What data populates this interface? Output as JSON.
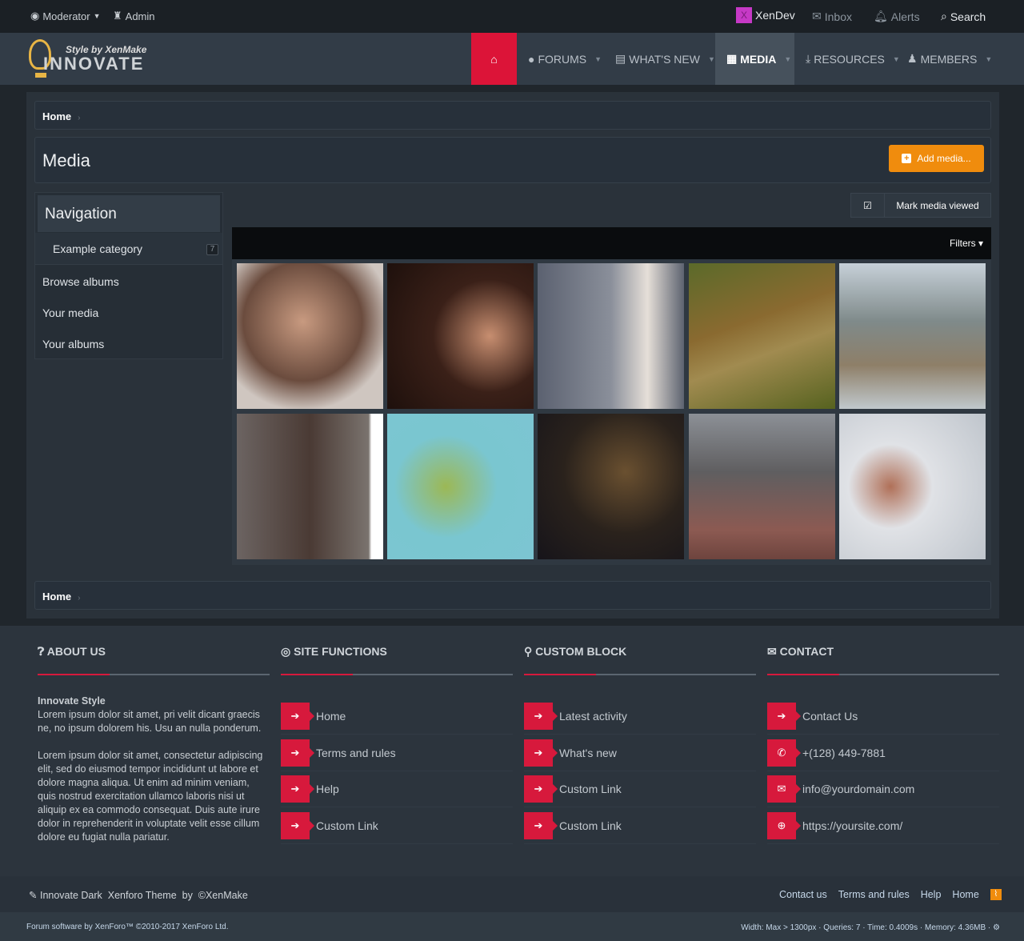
{
  "topbar": {
    "moderator": "Moderator",
    "admin": "Admin",
    "user": "XenDev",
    "user_initial": "X",
    "inbox": "Inbox",
    "alerts": "Alerts",
    "search": "Search"
  },
  "logo": {
    "tagline": "Style by XenMake",
    "name": "INNOVATE"
  },
  "nav": [
    {
      "label": "FORUMS"
    },
    {
      "label": "WHAT'S NEW"
    },
    {
      "label": "MEDIA"
    },
    {
      "label": "RESOURCES"
    },
    {
      "label": "MEMBERS"
    }
  ],
  "breadcrumb": {
    "home": "Home"
  },
  "page": {
    "title": "Media",
    "add_button": "Add media...",
    "mark_viewed": "Mark media viewed",
    "filters": "Filters"
  },
  "sidebar": {
    "title": "Navigation",
    "category": "Example category",
    "category_count": "7",
    "items": [
      "Browse albums",
      "Your media",
      "Your albums"
    ]
  },
  "footer": {
    "about": {
      "title": "ABOUT US",
      "heading": "Innovate Style",
      "p1": "Lorem ipsum dolor sit amet, pri velit dicant graecis ne, no ipsum dolorem his. Usu an nulla ponderum.",
      "p2": "Lorem ipsum dolor sit amet, consectetur adipiscing elit, sed do eiusmod tempor incididunt ut labore et dolore magna aliqua. Ut enim ad minim veniam, quis nostrud exercitation ullamco laboris nisi ut aliquip ex ea commodo consequat. Duis aute irure dolor in reprehenderit in voluptate velit esse cillum dolore eu fugiat nulla pariatur."
    },
    "site": {
      "title": "SITE FUNCTIONS",
      "links": [
        "Home",
        "Terms and rules",
        "Help",
        "Custom Link"
      ]
    },
    "custom": {
      "title": "CUSTOM BLOCK",
      "links": [
        "Latest activity",
        "What's new",
        "Custom Link",
        "Custom Link"
      ]
    },
    "contact": {
      "title": "CONTACT",
      "links": [
        "Contact Us",
        "+(128) 449-7881",
        "info@yourdomain.com",
        "https://yoursite.com/"
      ]
    },
    "credit": "Innovate Dark  Xenforo Theme  by  ©XenMake",
    "links": [
      "Contact us",
      "Terms and rules",
      "Help",
      "Home"
    ],
    "copyright": "Forum software by XenForo™ ©2010-2017 XenForo Ltd.",
    "debug": "Width: Max > 1300px · Queries: 7 · Time: 0.4009s · Memory: 4.36MB ·"
  }
}
